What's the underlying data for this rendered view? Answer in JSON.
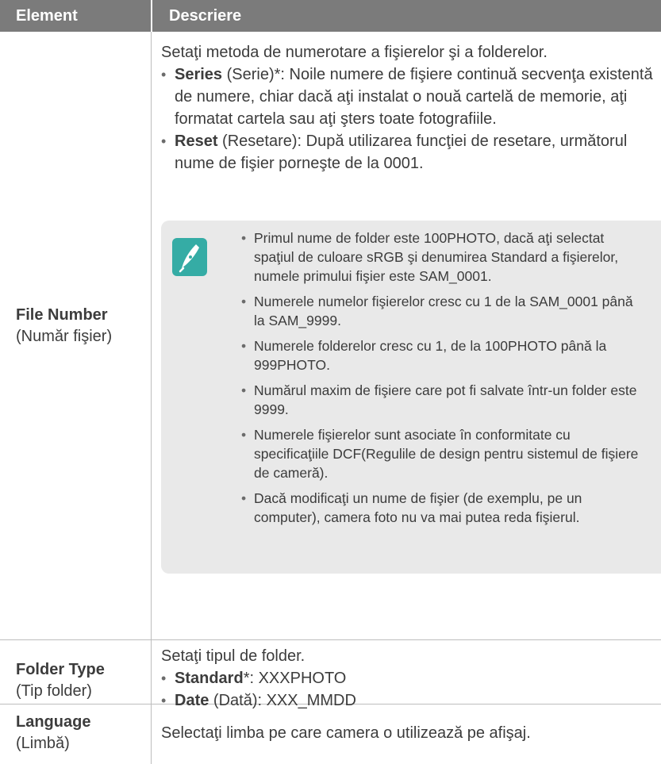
{
  "header": {
    "col1": "Element",
    "col2": "Descriere"
  },
  "rows": [
    {
      "name": "File Number",
      "name_ro": "(Număr fişier)",
      "intro": "Setaţi metoda de numerotare a fişierelor şi a folderelor.",
      "bullets": [
        {
          "term": "Series",
          "rest": " (Serie)*: Noile numere de fişiere continuă secvenţa existentă de numere, chiar dacă aţi instalat o nouă cartelă de memorie, aţi formatat cartela sau aţi şters toate fotografiile."
        },
        {
          "term": "Reset",
          "rest": " (Resetare): După utilizarea funcţiei de resetare, următorul nume de fişier porneşte de la 0001."
        }
      ],
      "notes": [
        "Primul nume de folder este 100PHOTO, dacă aţi selectat spaţiul de culoare sRGB şi denumirea Standard a fişierelor, numele primului fişier este SAM_0001.",
        "Numerele numelor fişierelor cresc cu 1 de la SAM_0001 până la SAM_9999.",
        "Numerele folderelor cresc cu 1, de la 100PHOTO până la 999PHOTO.",
        "Numărul maxim de fişiere care pot fi salvate într-un folder este 9999.",
        "Numerele fişierelor sunt asociate în conformitate cu specificaţiile DCF(Regulile de design pentru sistemul de fişiere de cameră).",
        "Dacă modificaţi un nume de fişier (de exemplu, pe un computer), camera foto nu va mai putea reda fişierul."
      ]
    },
    {
      "name": "Folder Type",
      "name_ro": "(Tip folder)",
      "intro": "Setaţi tipul de folder.",
      "bullets": [
        {
          "term": "Standard",
          "rest": "*: XXXPHOTO"
        },
        {
          "term": "Date",
          "rest": " (Dată): XXX_MMDD"
        }
      ]
    },
    {
      "name": "Language",
      "name_ro": "(Limbă)",
      "intro": "Selectaţi limba pe care camera o utilizează pe afişaj."
    }
  ],
  "icons": {
    "note": "note-pen-icon"
  },
  "colors": {
    "header_bg": "#7b7b7b",
    "note_bg": "#e9e9e9",
    "note_icon": "#35aca5"
  }
}
